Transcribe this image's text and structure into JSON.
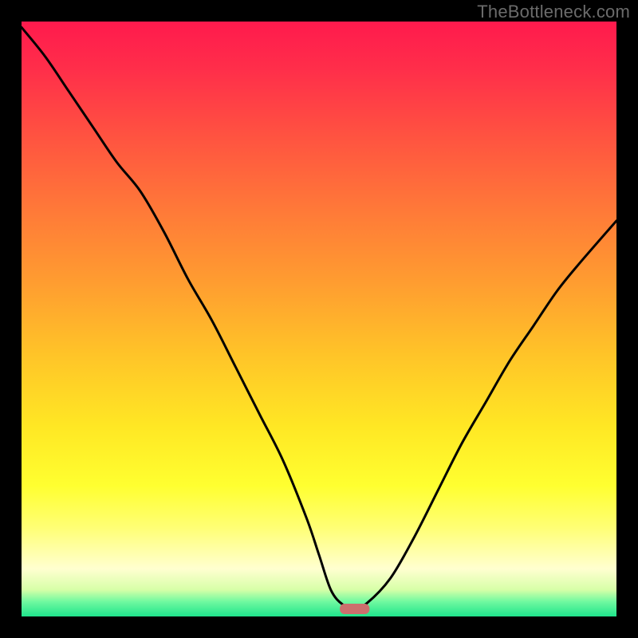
{
  "watermark": "TheBottleneck.com",
  "chart_data": {
    "type": "line",
    "title": "",
    "xlabel": "",
    "ylabel": "",
    "xlim": [
      0,
      100
    ],
    "ylim": [
      0,
      100
    ],
    "x": [
      0,
      4,
      8,
      12,
      16,
      20,
      24,
      28,
      32,
      36,
      40,
      44,
      48,
      50,
      52,
      54,
      56,
      58,
      62,
      66,
      70,
      74,
      78,
      82,
      86,
      90,
      94,
      100
    ],
    "values": [
      99,
      94,
      88,
      82,
      76,
      71,
      64,
      56,
      49,
      41,
      33,
      25,
      15,
      9,
      3,
      0.5,
      0,
      0.7,
      5,
      12,
      20,
      28,
      35,
      42,
      48,
      54,
      59,
      66
    ],
    "marker": {
      "x": 56,
      "width": 5,
      "color": "#CC6F6D"
    },
    "background_gradient": {
      "top": "#FF1A4D",
      "middle": "#FFE724",
      "bottom": "#1FE48C"
    }
  }
}
